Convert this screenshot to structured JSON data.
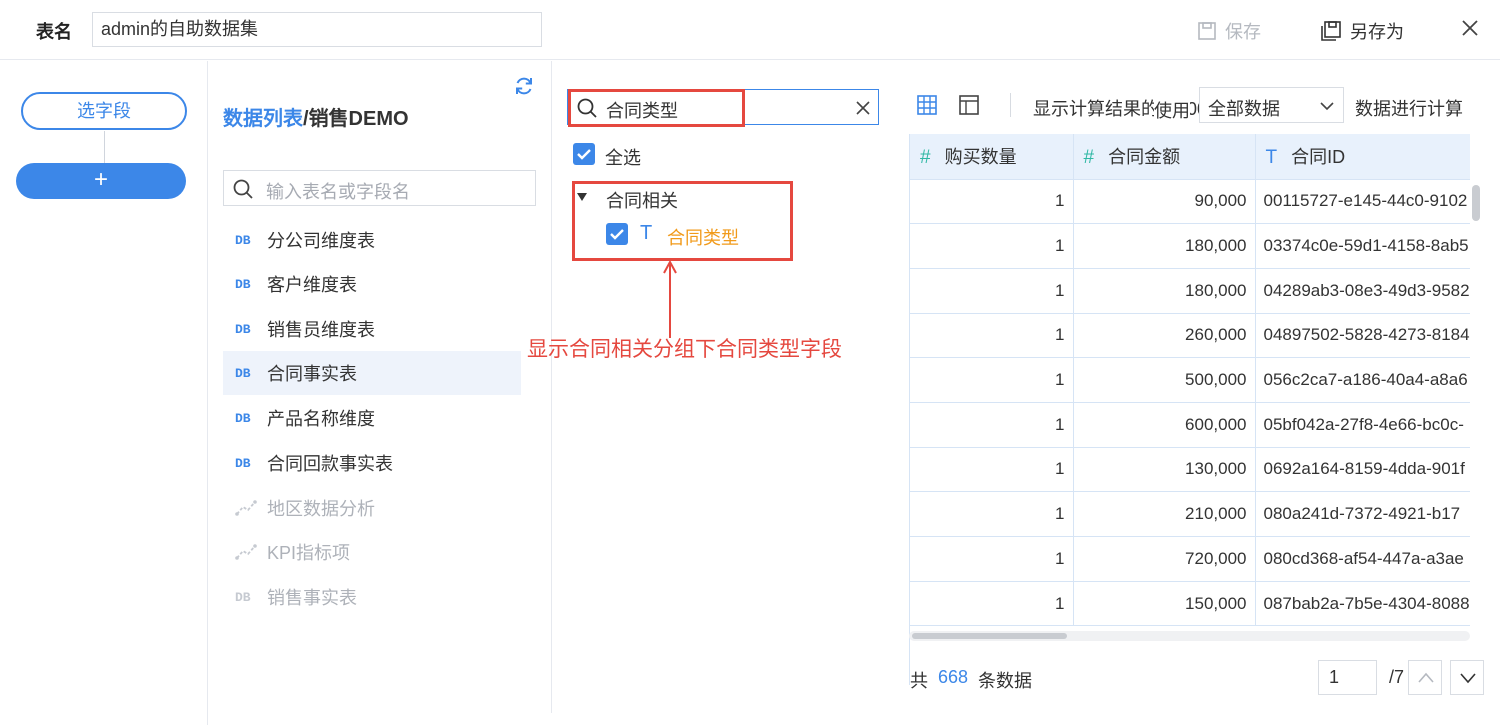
{
  "header": {
    "name_label": "表名",
    "name_value": "admin的自助数据集",
    "save_label": "保存",
    "save_as_label": "另存为"
  },
  "steps": {
    "select_fields": "选字段",
    "add": "+"
  },
  "list_panel": {
    "breadcrumb_root": "数据列表",
    "breadcrumb_sep": "/",
    "breadcrumb_current": "销售DEMO",
    "search_placeholder": "输入表名或字段名",
    "tables": [
      {
        "icon": "DB",
        "label": "分公司维度表"
      },
      {
        "icon": "DB",
        "label": "客户维度表"
      },
      {
        "icon": "DB",
        "label": "销售员维度表"
      },
      {
        "icon": "DB",
        "label": "合同事实表"
      },
      {
        "icon": "DB",
        "label": "产品名称维度"
      },
      {
        "icon": "DB",
        "label": "合同回款事实表"
      },
      {
        "icon": "analysis",
        "label": "地区数据分析"
      },
      {
        "icon": "analysis",
        "label": "KPI指标项"
      },
      {
        "icon": "DB",
        "label": "销售事实表"
      }
    ]
  },
  "field_panel": {
    "search_value": "合同类型",
    "select_all": "全选",
    "group_name": "合同相关",
    "field_type_icon": "T",
    "field_name": "合同类型",
    "annotation": "显示合同相关分组下合同类型字段"
  },
  "preview": {
    "calc_prefix": "显示计算结果的前5000行",
    "calc_use": "使用",
    "calc_option": "全部数据",
    "calc_suffix": "数据进行计算",
    "columns": [
      {
        "type_icon": "#",
        "name": "购买数量"
      },
      {
        "type_icon": "#",
        "name": "合同金额"
      },
      {
        "type_icon": "T",
        "name": "合同ID"
      }
    ],
    "rows": [
      [
        "1",
        "90,000",
        "00115727-e145-44c0-9102"
      ],
      [
        "1",
        "180,000",
        "03374c0e-59d1-4158-8ab5"
      ],
      [
        "1",
        "180,000",
        "04289ab3-08e3-49d3-9582"
      ],
      [
        "1",
        "260,000",
        "04897502-5828-4273-8184"
      ],
      [
        "1",
        "500,000",
        "056c2ca7-a186-40a4-a8a6"
      ],
      [
        "1",
        "600,000",
        "05bf042a-27f8-4e66-bc0c-"
      ],
      [
        "1",
        "130,000",
        "0692a164-8159-4dda-901f"
      ],
      [
        "1",
        "210,000",
        "080a241d-7372-4921-b17"
      ],
      [
        "1",
        "720,000",
        "080cd368-af54-447a-a3ae"
      ],
      [
        "1",
        "150,000",
        "087bab2a-7b5e-4304-8088"
      ]
    ],
    "footer_prefix": "共",
    "total_count": "668",
    "footer_suffix": "条数据",
    "current_page": "1",
    "total_pages": "/7"
  },
  "colors": {
    "accent": "#3c87e8",
    "annotation_red": "#e5483f",
    "field_orange": "#f19a1a",
    "number_type": "#2fb8a4"
  }
}
